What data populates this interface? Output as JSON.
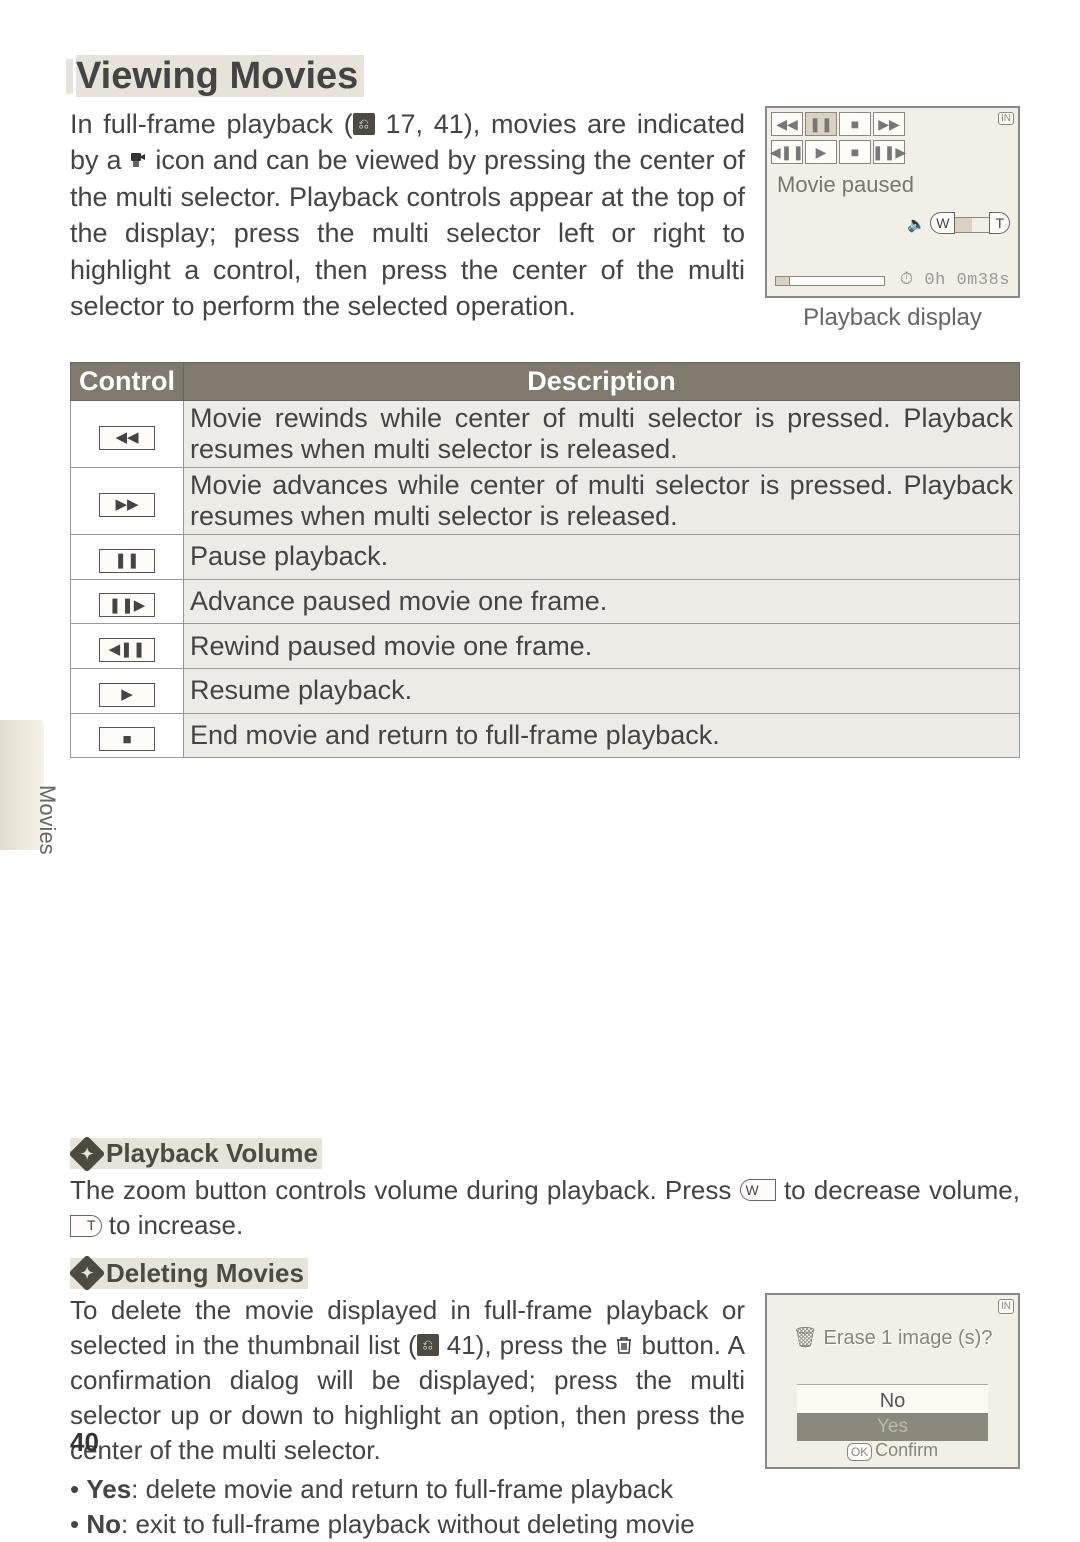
{
  "title": "Viewing Movies",
  "intro": {
    "part1": "In full-frame playback (",
    "refs": "17, 41",
    "part2": "), movies are indicated by a ",
    "part3": " icon and can be viewed by pressing the center of the multi selector.  Playback controls appear at the top of the display; press the multi selector left or right to highlight a control, then press the center of the multi selector to perform the selected operation."
  },
  "display": {
    "status": "Movie paused",
    "time": "0h 0m38s",
    "caption": "Playback display",
    "in": "IN",
    "vol_w": "W",
    "vol_t": "T"
  },
  "table": {
    "h1": "Control",
    "h2": "Description",
    "rows": [
      {
        "icon": "◀◀",
        "desc": "Movie rewinds while center of multi selector is pressed.  Playback resumes when multi selector is released."
      },
      {
        "icon": "▶▶",
        "desc": "Movie advances while center of multi selector is pressed.  Playback resumes when multi selector is released."
      },
      {
        "icon": "❚❚",
        "desc": "Pause playback."
      },
      {
        "icon": "❚❚▶",
        "desc": "Advance paused movie one frame."
      },
      {
        "icon": "◀❚❚",
        "desc": "Rewind paused movie one frame."
      },
      {
        "icon": "▶",
        "desc": "Resume playback."
      },
      {
        "icon": "■",
        "desc": "End movie and return to full-frame playback."
      }
    ]
  },
  "side_label": "Movies",
  "note1": {
    "head": "Playback Volume",
    "body_a": "The zoom button controls volume during playback.  Press ",
    "w": "W",
    "body_b": " to decrease volume, ",
    "t": "T",
    "body_c": " to increase."
  },
  "note2": {
    "head": "Deleting Movies",
    "body_a": "To delete the movie displayed in full-frame playback or selected in the thumbnail list (",
    "ref": "41",
    "body_b": "), press the ",
    "body_c": " button.  A confirmation dialog will be displayed; press the multi selector up or down to highlight an option, then press the center of the multi selector.",
    "bullet_yes": "Yes: delete movie and return to full-frame playback",
    "bullet_no": "No: exit to full-frame playback without deleting movie",
    "yes_bold": "Yes",
    "no_bold": "No",
    "yes_rest": ": delete movie and return to full-frame playback",
    "no_rest": ": exit to full-frame playback without deleting movie"
  },
  "erase": {
    "title": "Erase 1 image (s)?",
    "no": "No",
    "yes": "Yes",
    "confirm": "Confirm",
    "in": "IN",
    "ok": "OK"
  },
  "page": "40"
}
